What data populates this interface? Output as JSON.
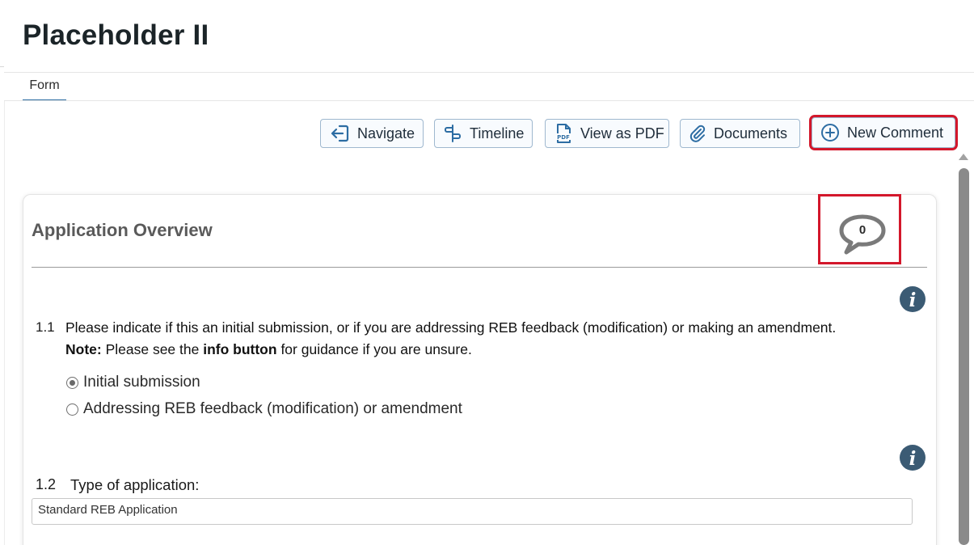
{
  "page": {
    "title": "Placeholder II"
  },
  "tabs": [
    {
      "label": "Form"
    }
  ],
  "toolbar": {
    "navigate": "Navigate",
    "timeline": "Timeline",
    "view_pdf": "View as PDF",
    "documents": "Documents",
    "new_comment": "New Comment",
    "icons": [
      "navigate-icon",
      "timeline-icon",
      "pdf-icon",
      "paperclip-icon",
      "plus-circle-icon"
    ]
  },
  "section": {
    "title": "Application Overview",
    "comment_count": "0",
    "icon": "comment-bubble-icon"
  },
  "questions": [
    {
      "number": "1.1",
      "text": "Please indicate if this an initial submission, or if you are addressing REB feedback (modification) or making an amendment.",
      "note_label": "Note:",
      "note_pre": " Please see the ",
      "note_bold": "info button",
      "note_post": " for guidance if you are unsure.",
      "options": [
        {
          "label": "Initial submission",
          "selected": true
        },
        {
          "label": "Addressing REB feedback (modification) or amendment",
          "selected": false
        }
      ]
    },
    {
      "number": "1.2",
      "text": "Type of application:",
      "value": "Standard REB Application"
    }
  ],
  "colors": {
    "accent": "#2d6da3",
    "highlight": "#d3172b",
    "info_icon": "#3b5b74",
    "button_border": "#9fb8cf"
  }
}
